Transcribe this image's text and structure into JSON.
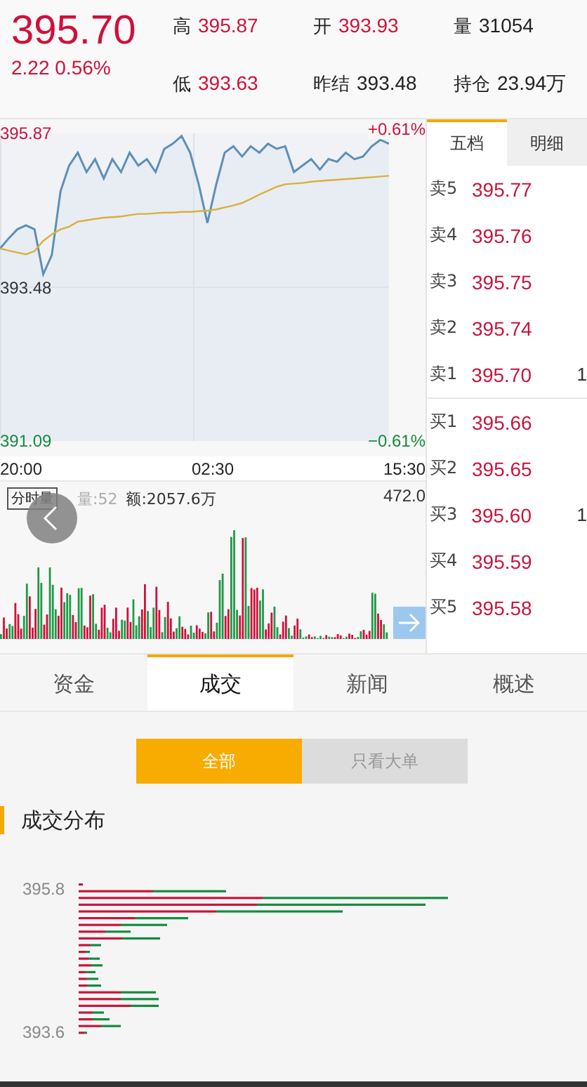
{
  "quote": {
    "price": "395.70",
    "change": "2.22 0.56%",
    "stats": [
      {
        "label": "高",
        "value": "395.87",
        "kind": "up"
      },
      {
        "label": "开",
        "value": "393.93",
        "kind": "up"
      },
      {
        "label": "量",
        "value": "31054",
        "kind": "plain"
      },
      {
        "label": "低",
        "value": "393.63",
        "kind": "up"
      },
      {
        "label": "昨结",
        "value": "393.48",
        "kind": "plain"
      },
      {
        "label": "持仓",
        "value": "23.94万",
        "kind": "plain"
      }
    ]
  },
  "price_chart": {
    "up_pct": "+0.61%",
    "down_pct": "−0.61%",
    "time_labels": [
      "20:00",
      "02:30",
      "15:30"
    ],
    "chart_data": {
      "type": "line",
      "series": [
        {
          "color": "#5d8fb8",
          "values": [
            394.08,
            394.24,
            394.38,
            394.44,
            394.38,
            393.68,
            393.98,
            394.97,
            395.37,
            395.57,
            395.27,
            395.47,
            395.17,
            395.47,
            395.27,
            395.57,
            395.37,
            395.47,
            395.27,
            395.63,
            395.71,
            395.83,
            395.57,
            395.07,
            394.48,
            395.07,
            395.57,
            395.67,
            395.51,
            395.67,
            395.57,
            395.71,
            395.63,
            395.67,
            395.27,
            395.37,
            395.47,
            395.31,
            395.47,
            395.43,
            395.57,
            395.47,
            395.51,
            395.67,
            395.77,
            395.71
          ]
        },
        {
          "color": "#d9b13a",
          "values": [
            394.08,
            394.05,
            394.02,
            393.99,
            394.04,
            394.2,
            394.3,
            394.38,
            394.42,
            394.5,
            394.52,
            394.54,
            394.56,
            394.57,
            394.58,
            394.6,
            394.62,
            394.62,
            394.63,
            394.64,
            394.64,
            394.65,
            394.65,
            394.66,
            394.67,
            394.69,
            394.72,
            394.75,
            394.79,
            394.85,
            394.92,
            394.98,
            395.04,
            395.08,
            395.09,
            395.1,
            395.12,
            395.13,
            395.14,
            395.15,
            395.16,
            395.17,
            395.18,
            395.19,
            395.2,
            395.21
          ]
        }
      ],
      "ylim": [
        391.09,
        395.87
      ],
      "yticks": [
        {
          "value": 395.87,
          "label": "395.87"
        },
        {
          "value": 393.48,
          "label": "393.48"
        },
        {
          "value": 391.09,
          "label": "391.09"
        }
      ]
    }
  },
  "volume_chart": {
    "tag": "分时量",
    "volume": "量:52",
    "amount": "额:2057.6万",
    "max_label": "472.0"
  },
  "side_tabs": [
    {
      "label": "五档",
      "selected": true
    },
    {
      "label": "明细",
      "selected": false
    }
  ],
  "order_book": {
    "asks": [
      {
        "label": "卖5",
        "price": "395.77"
      },
      {
        "label": "卖4",
        "price": "395.76"
      },
      {
        "label": "卖3",
        "price": "395.75"
      },
      {
        "label": "卖2",
        "price": "395.74"
      },
      {
        "label": "卖1",
        "price": "395.70",
        "volume": "1"
      }
    ],
    "bids": [
      {
        "label": "买1",
        "price": "395.66"
      },
      {
        "label": "买2",
        "price": "395.65"
      },
      {
        "label": "买3",
        "price": "395.60",
        "volume": "1"
      },
      {
        "label": "买4",
        "price": "395.59"
      },
      {
        "label": "买5",
        "price": "395.58"
      }
    ]
  },
  "tabs": [
    {
      "label": "资金",
      "selected": false
    },
    {
      "label": "成交",
      "selected": true
    },
    {
      "label": "新闻",
      "selected": false
    },
    {
      "label": "概述",
      "selected": false
    }
  ],
  "filters": [
    {
      "label": "全部",
      "selected": true
    },
    {
      "label": "只看大单",
      "selected": false
    }
  ],
  "distribution": {
    "title": "成交分布",
    "top_label": "395.8",
    "bottom_label": "393.6"
  }
}
